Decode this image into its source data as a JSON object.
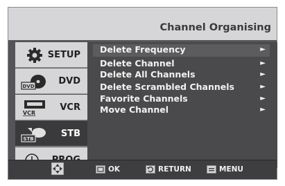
{
  "header": {
    "title": "Channel Organising"
  },
  "sidebar": {
    "items": [
      {
        "label": "SETUP",
        "icon": "gear-icon",
        "active": false
      },
      {
        "label": "DVD",
        "icon": "dvd-disc-icon",
        "active": false,
        "icon_text": "DVD"
      },
      {
        "label": "VCR",
        "icon": "vcr-tape-icon",
        "active": false,
        "icon_text": "VCR"
      },
      {
        "label": "STB",
        "icon": "satellite-dish-icon",
        "active": true,
        "icon_text": "STB"
      },
      {
        "label": "PROG",
        "icon": "clock-icon",
        "active": false
      }
    ]
  },
  "menu": {
    "items": [
      {
        "label": "Delete Frequency",
        "arrow": "►",
        "highlighted": true
      },
      {
        "label": "Delete Channel",
        "arrow": "►",
        "highlighted": false
      },
      {
        "label": "Delete All Channels",
        "arrow": "►",
        "highlighted": false
      },
      {
        "label": "Delete Scrambled Channels",
        "arrow": "►",
        "highlighted": false
      },
      {
        "label": "Favorite Channels",
        "arrow": "►",
        "highlighted": false
      },
      {
        "label": "Move Channel",
        "arrow": "►",
        "highlighted": false
      }
    ]
  },
  "footer": {
    "ok_label": "OK",
    "return_label": "RETURN",
    "menu_label": "MENU"
  },
  "colors": {
    "background": "#555557",
    "panel_light": "#d6d6d8",
    "active_item": "#3a3a3c",
    "text_light": "#f2f2f2"
  }
}
